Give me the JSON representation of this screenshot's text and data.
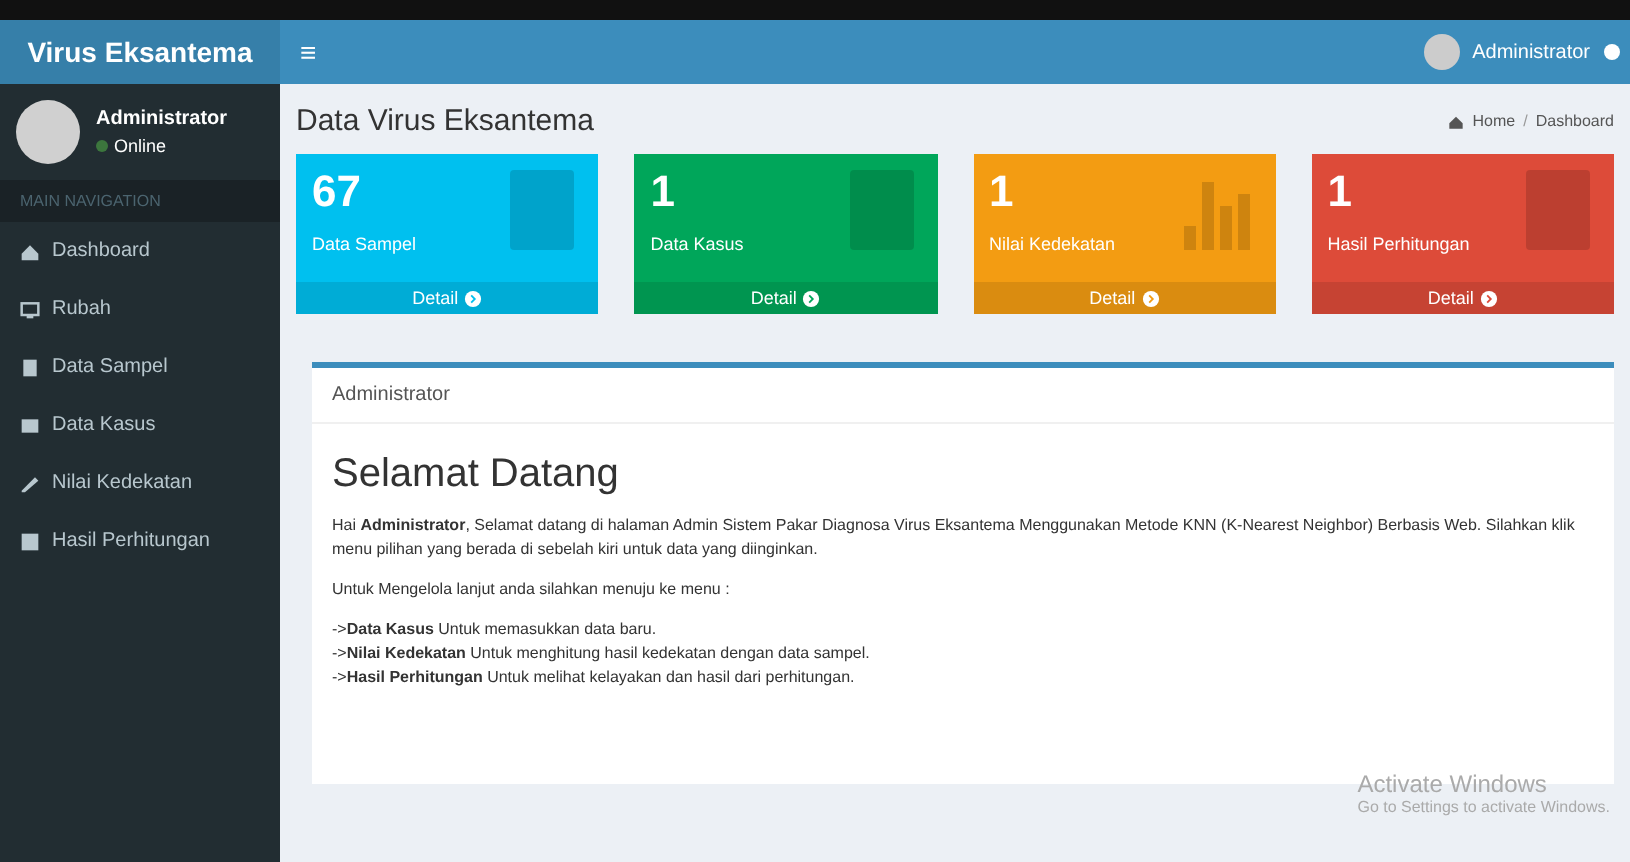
{
  "navbar": {
    "brand": "Virus Eksantema",
    "menu_toggle": "≡",
    "user": "Administrator"
  },
  "sidebar": {
    "user": {
      "name": "Administrator",
      "status": "Online"
    },
    "header": "MAIN NAVIGATION",
    "items": [
      {
        "label": "Dashboard"
      },
      {
        "label": "Rubah"
      },
      {
        "label": "Data Sampel"
      },
      {
        "label": "Data Kasus"
      },
      {
        "label": "Nilai Kedekatan"
      },
      {
        "label": "Hasil Perhitungan"
      }
    ]
  },
  "page": {
    "title": "Data Virus Eksantema",
    "breadcrumb": [
      "Home",
      "Dashboard"
    ],
    "breadcrumb_separator": "/"
  },
  "stat_boxes": [
    {
      "value": "67",
      "label": "Data Sampel",
      "link": "Detail",
      "color": "#00c0ef"
    },
    {
      "value": "1",
      "label": "Data Kasus",
      "link": "Detail",
      "color": "#00a65a"
    },
    {
      "value": "1",
      "label": "Nilai Kedekatan",
      "link": "Detail",
      "color": "#f39c12"
    },
    {
      "value": "1",
      "label": "Hasil Perhitungan",
      "link": "Detail",
      "color": "#dd4b39"
    }
  ],
  "welcome_card": {
    "header": "Administrator",
    "heading": "Selamat Datang",
    "paragraphs": [
      "Hai **Administrator**, Selamat datang di halaman Admin Sistem Pakar Diagnosa Virus Eksantema Menggunakan Metode KNN (K-Nearest Neighbor) Berbasis Web. Silahkan klik menu pilihan yang berada di sebelah kiri untuk data yang diinginkan.",
      "Untuk Mengelola lanjut anda silahkan menuju ke menu :"
    ],
    "menu_notes": [
      "->**Data Kasus** Untuk memasukkan data baru.",
      "->**Nilai Kedekatan** Untuk menghitung hasil kedekatan dengan data sampel.",
      "->**Hasil Perhitungan** Untuk melihat kelayakan dan hasil dari perhitungan."
    ]
  },
  "os_notice": {
    "title": "Activate Windows",
    "subtitle": "Go to Settings to activate Windows."
  }
}
